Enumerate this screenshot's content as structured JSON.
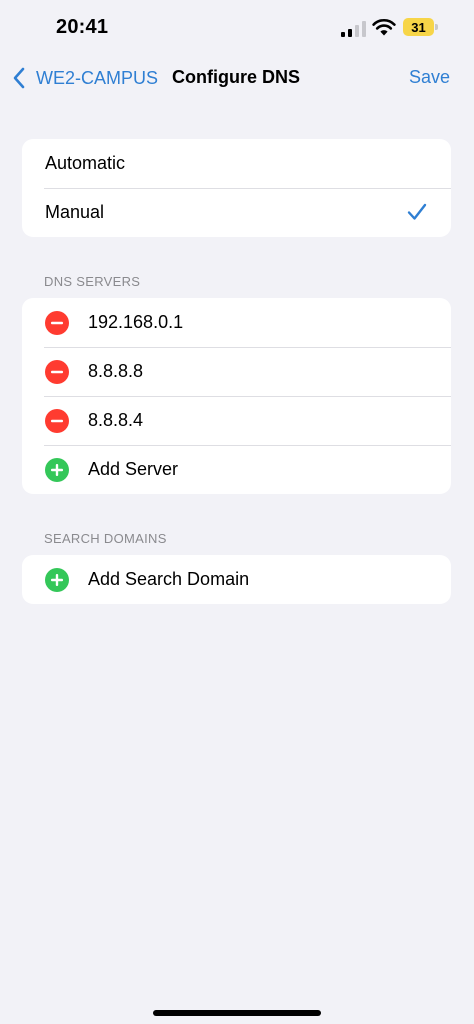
{
  "status_bar": {
    "time": "20:41",
    "battery_level": "31"
  },
  "nav": {
    "back_label": "WE2-CAMPUS",
    "title": "Configure DNS",
    "save_label": "Save"
  },
  "mode_group": {
    "options": [
      {
        "label": "Automatic",
        "selected": false
      },
      {
        "label": "Manual",
        "selected": true
      }
    ]
  },
  "dns_servers": {
    "header": "DNS SERVERS",
    "servers": [
      "192.168.0.1",
      "8.8.8.8",
      "8.8.8.4"
    ],
    "add_label": "Add Server"
  },
  "search_domains": {
    "header": "SEARCH DOMAINS",
    "add_label": "Add Search Domain"
  },
  "colors": {
    "accent": "#2f7fd3",
    "delete": "#ff3b30",
    "add": "#34c759",
    "background": "#f2f2f7"
  }
}
